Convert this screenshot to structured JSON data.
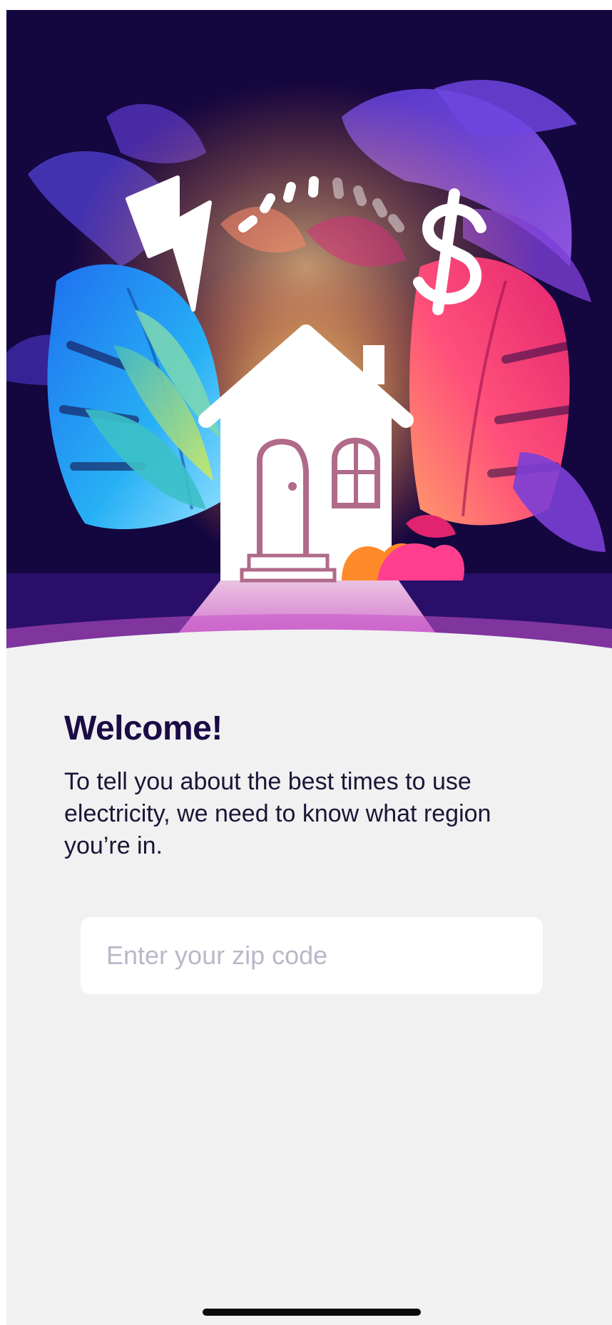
{
  "hero": {
    "illustration": "house-energy-illustration",
    "colors": {
      "night": "#14063f",
      "glow": "#ffd27a",
      "pink": "#ff3f8e",
      "blue": "#1c9af0",
      "purple": "#7b3fd6"
    }
  },
  "welcome": {
    "title": "Welcome!",
    "body": "To tell you about the best times to use electricity, we need to know what region you’re in."
  },
  "zip": {
    "placeholder": "Enter your zip code",
    "value": ""
  }
}
